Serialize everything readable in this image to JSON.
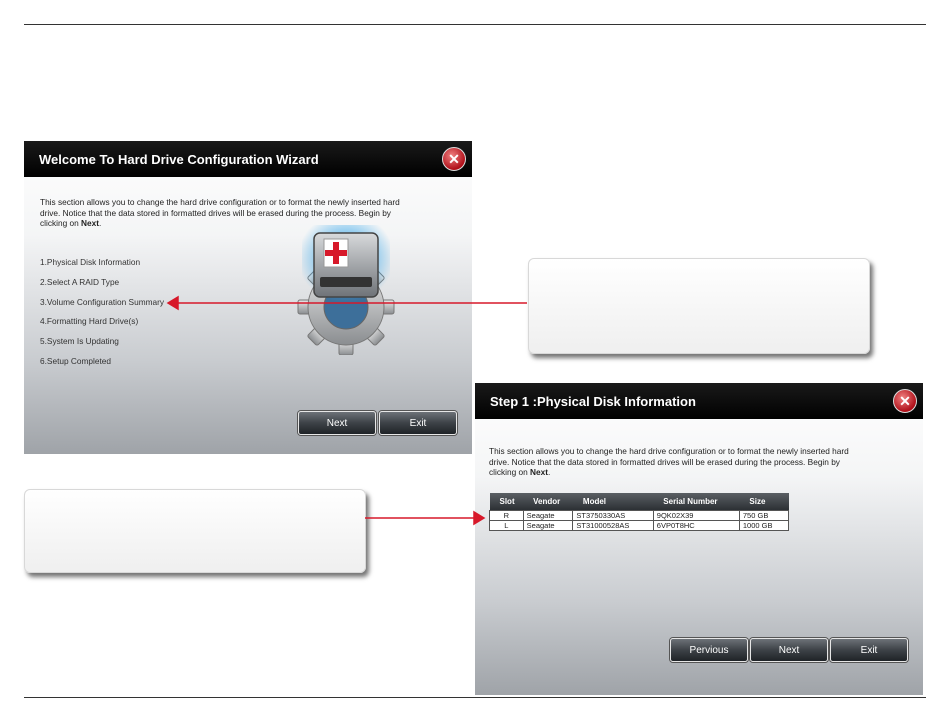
{
  "wizard1": {
    "title": "Welcome To Hard Drive Configuration Wizard",
    "close_label": "✕",
    "desc_main": "This section allows you to change the hard drive configuration or to format the newly inserted hard drive. Notice that the data stored in formatted drives will be erased during the process. Begin by clicking on ",
    "desc_bold": "Next",
    "desc_end": ".",
    "steps": [
      "1.Physical Disk Information",
      "2.Select A RAID Type",
      "3.Volume Configuration Summary",
      "4.Formatting Hard Drive(s)",
      "5.System Is Updating",
      "6.Setup Completed"
    ],
    "next_label": "Next",
    "exit_label": "Exit",
    "icon": "hard-drive-gear-icon"
  },
  "wizard2": {
    "title": "Step 1 :Physical Disk Information",
    "close_label": "✕",
    "desc_main": "This section allows you to change the hard drive configuration or to format the newly inserted hard drive. Notice that the data stored in formatted drives will be erased during the process. Begin by clicking on ",
    "desc_bold": "Next",
    "desc_end": ".",
    "table": {
      "columns": [
        "Slot",
        "Vendor",
        "Model",
        "Serial Number",
        "Size"
      ],
      "rows": [
        [
          "R",
          "Seagate",
          "ST3750330AS",
          "9QK02X39",
          "750 GB"
        ],
        [
          "L",
          "Seagate",
          "ST31000528AS",
          "6VP0T8HC",
          "1000 GB"
        ]
      ]
    },
    "previous_label": "Pervious",
    "next_label": "Next",
    "exit_label": "Exit"
  },
  "colors": {
    "arrow": "#d7192a",
    "titlebar": "#000000",
    "close_button": "#c0182a"
  }
}
